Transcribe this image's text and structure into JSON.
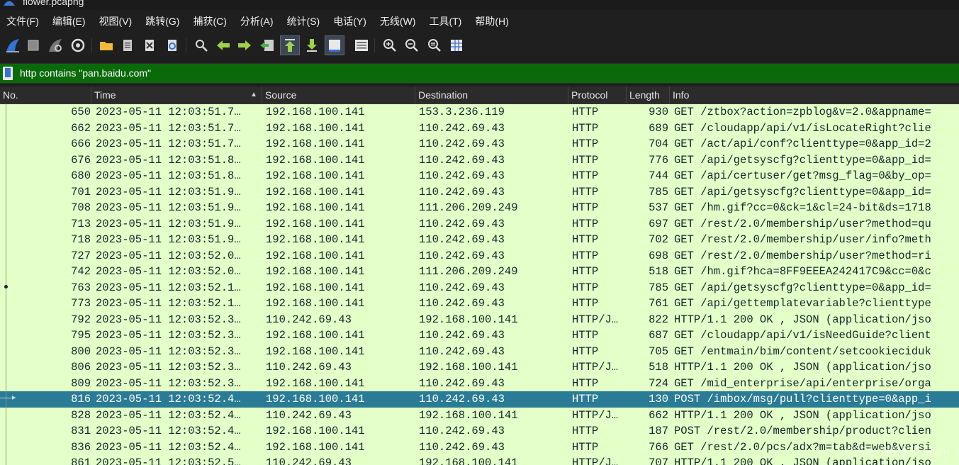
{
  "window": {
    "title": "flower.pcapng"
  },
  "menu": [
    "文件(F)",
    "编辑(E)",
    "视图(V)",
    "跳转(G)",
    "捕获(C)",
    "分析(A)",
    "统计(S)",
    "电话(Y)",
    "无线(W)",
    "工具(T)",
    "帮助(H)"
  ],
  "filter": {
    "value": "http contains \"pan.baidu.com\""
  },
  "columns": [
    "No.",
    "Time",
    "Source",
    "Destination",
    "Protocol",
    "Length",
    "Info"
  ],
  "packets": [
    {
      "no": "650",
      "time": "2023-05-11 12:03:51.7…",
      "src": "192.168.100.141",
      "dst": "153.3.236.119",
      "proto": "HTTP",
      "len": "930",
      "info": "GET /ztbox?action=zpblog&v=2.0&appname="
    },
    {
      "no": "662",
      "time": "2023-05-11 12:03:51.7…",
      "src": "192.168.100.141",
      "dst": "110.242.69.43",
      "proto": "HTTP",
      "len": "689",
      "info": "GET /cloudapp/api/v1/isLocateRight?clie"
    },
    {
      "no": "666",
      "time": "2023-05-11 12:03:51.7…",
      "src": "192.168.100.141",
      "dst": "110.242.69.43",
      "proto": "HTTP",
      "len": "704",
      "info": "GET /act/api/conf?clienttype=0&app_id=2"
    },
    {
      "no": "676",
      "time": "2023-05-11 12:03:51.8…",
      "src": "192.168.100.141",
      "dst": "110.242.69.43",
      "proto": "HTTP",
      "len": "776",
      "info": "GET /api/getsyscfg?clienttype=0&app_id="
    },
    {
      "no": "680",
      "time": "2023-05-11 12:03:51.8…",
      "src": "192.168.100.141",
      "dst": "110.242.69.43",
      "proto": "HTTP",
      "len": "744",
      "info": "GET /api/certuser/get?msg_flag=0&by_op="
    },
    {
      "no": "701",
      "time": "2023-05-11 12:03:51.9…",
      "src": "192.168.100.141",
      "dst": "110.242.69.43",
      "proto": "HTTP",
      "len": "785",
      "info": "GET /api/getsyscfg?clienttype=0&app_id="
    },
    {
      "no": "708",
      "time": "2023-05-11 12:03:51.9…",
      "src": "192.168.100.141",
      "dst": "111.206.209.249",
      "proto": "HTTP",
      "len": "537",
      "info": "GET /hm.gif?cc=0&ck=1&cl=24-bit&ds=1718"
    },
    {
      "no": "713",
      "time": "2023-05-11 12:03:51.9…",
      "src": "192.168.100.141",
      "dst": "110.242.69.43",
      "proto": "HTTP",
      "len": "697",
      "info": "GET /rest/2.0/membership/user?method=qu"
    },
    {
      "no": "718",
      "time": "2023-05-11 12:03:51.9…",
      "src": "192.168.100.141",
      "dst": "110.242.69.43",
      "proto": "HTTP",
      "len": "702",
      "info": "GET /rest/2.0/membership/user/info?meth"
    },
    {
      "no": "727",
      "time": "2023-05-11 12:03:52.0…",
      "src": "192.168.100.141",
      "dst": "110.242.69.43",
      "proto": "HTTP",
      "len": "698",
      "info": "GET /rest/2.0/membership/user?method=ri"
    },
    {
      "no": "742",
      "time": "2023-05-11 12:03:52.0…",
      "src": "192.168.100.141",
      "dst": "111.206.209.249",
      "proto": "HTTP",
      "len": "518",
      "info": "GET /hm.gif?hca=8FF9EEEA242417C9&cc=0&c"
    },
    {
      "no": "763",
      "time": "2023-05-11 12:03:52.1…",
      "src": "192.168.100.141",
      "dst": "110.242.69.43",
      "proto": "HTTP",
      "len": "785",
      "info": "GET /api/getsyscfg?clienttype=0&app_id="
    },
    {
      "no": "773",
      "time": "2023-05-11 12:03:52.1…",
      "src": "192.168.100.141",
      "dst": "110.242.69.43",
      "proto": "HTTP",
      "len": "761",
      "info": "GET /api/gettemplatevariable?clienttype"
    },
    {
      "no": "792",
      "time": "2023-05-11 12:03:52.3…",
      "src": "110.242.69.43",
      "dst": "192.168.100.141",
      "proto": "HTTP/J…",
      "len": "822",
      "info": "HTTP/1.1 200 OK , JSON (application/jso"
    },
    {
      "no": "795",
      "time": "2023-05-11 12:03:52.3…",
      "src": "192.168.100.141",
      "dst": "110.242.69.43",
      "proto": "HTTP",
      "len": "687",
      "info": "GET /cloudapp/api/v1/isNeedGuide?client"
    },
    {
      "no": "800",
      "time": "2023-05-11 12:03:52.3…",
      "src": "192.168.100.141",
      "dst": "110.242.69.43",
      "proto": "HTTP",
      "len": "705",
      "info": "GET /entmain/bim/content/setcookieciduk"
    },
    {
      "no": "806",
      "time": "2023-05-11 12:03:52.3…",
      "src": "110.242.69.43",
      "dst": "192.168.100.141",
      "proto": "HTTP/J…",
      "len": "518",
      "info": "HTTP/1.1 200 OK , JSON (application/jso"
    },
    {
      "no": "809",
      "time": "2023-05-11 12:03:52.3…",
      "src": "192.168.100.141",
      "dst": "110.242.69.43",
      "proto": "HTTP",
      "len": "724",
      "info": "GET /mid_enterprise/api/enterprise/orga"
    },
    {
      "no": "816",
      "time": "2023-05-11 12:03:52.4…",
      "src": "192.168.100.141",
      "dst": "110.242.69.43",
      "proto": "HTTP",
      "len": "130",
      "info": "POST /imbox/msg/pull?clienttype=0&app_i",
      "selected": true
    },
    {
      "no": "828",
      "time": "2023-05-11 12:03:52.4…",
      "src": "110.242.69.43",
      "dst": "192.168.100.141",
      "proto": "HTTP/J…",
      "len": "662",
      "info": "HTTP/1.1 200 OK , JSON (application/jso"
    },
    {
      "no": "831",
      "time": "2023-05-11 12:03:52.4…",
      "src": "192.168.100.141",
      "dst": "110.242.69.43",
      "proto": "HTTP",
      "len": "187",
      "info": "POST /rest/2.0/membership/product?clien"
    },
    {
      "no": "836",
      "time": "2023-05-11 12:03:52.4…",
      "src": "192.168.100.141",
      "dst": "110.242.69.43",
      "proto": "HTTP",
      "len": "766",
      "info": "GET /rest/2.0/pcs/adx?m=tab&d=web&versi"
    },
    {
      "no": "861",
      "time": "2023-05-11 12:03:52.5…",
      "src": "110.242.69.43",
      "dst": "192.168.100.141",
      "proto": "HTTP/J…",
      "len": "707",
      "info": "HTTP/1.1 200 OK , JSON (application/jso"
    }
  ],
  "watermark": "CSDN @阿呆不呆@u",
  "colors": {
    "row_bg": "#e4ffc7",
    "selected_bg": "#2a7b95",
    "filter_bg": "#0a6a0a"
  }
}
